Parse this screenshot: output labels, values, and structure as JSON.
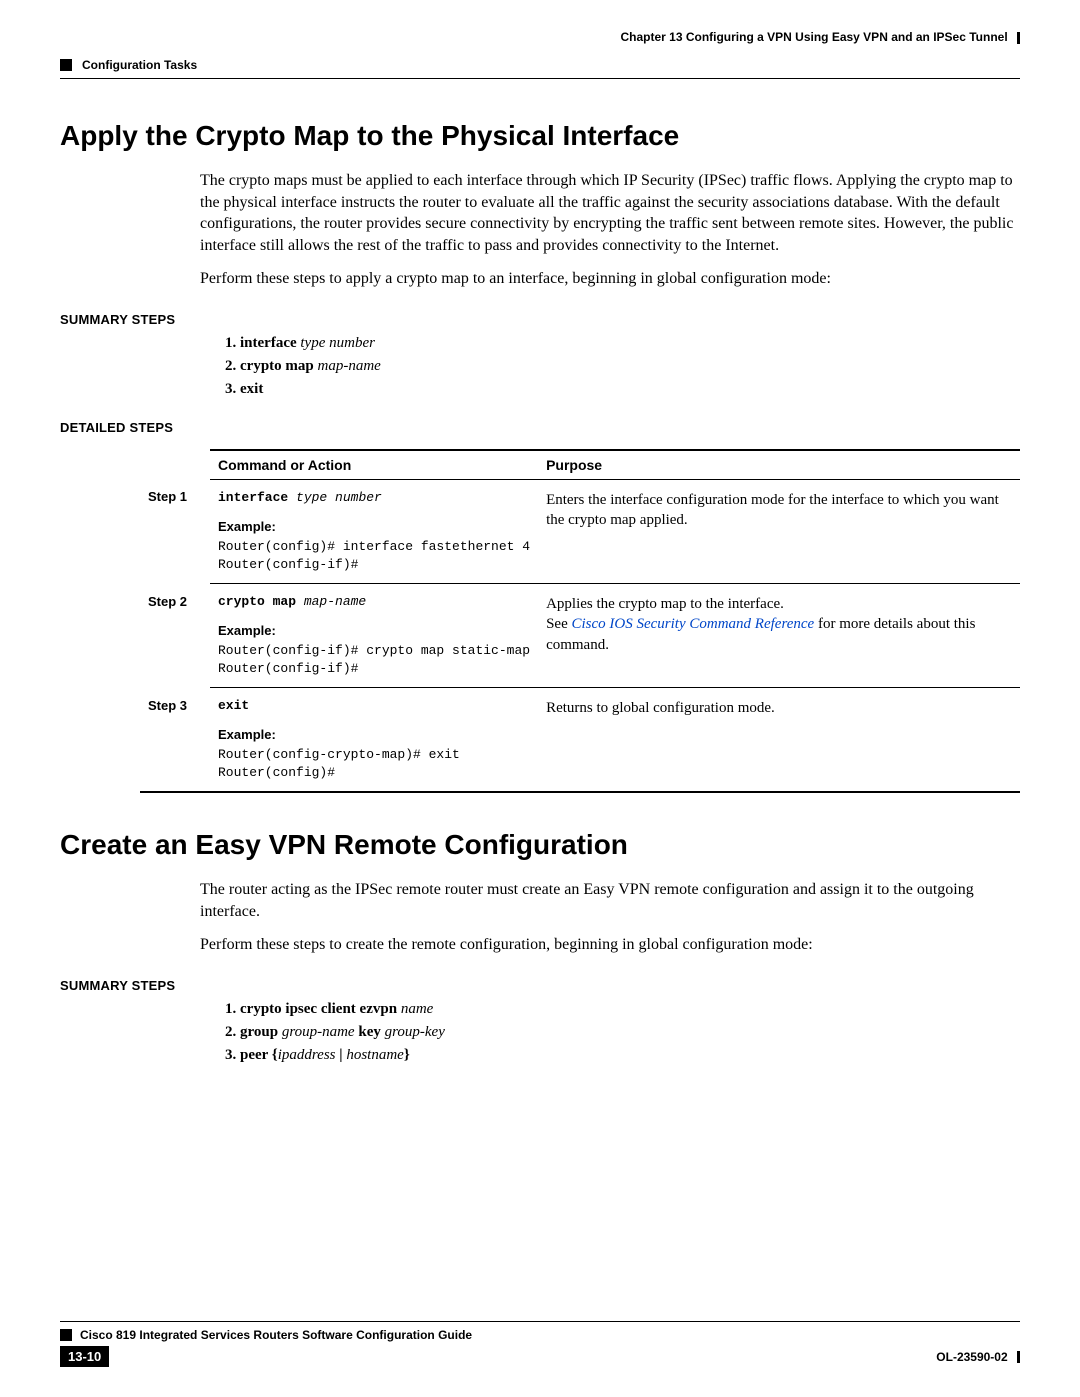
{
  "header": {
    "chapter": "Chapter 13    Configuring a VPN Using Easy VPN and an IPSec Tunnel",
    "subtitle": "Configuration Tasks"
  },
  "section1": {
    "title": "Apply the Crypto Map to the Physical Interface",
    "para1": "The crypto maps must be applied to each interface through which IP Security (IPSec) traffic flows. Applying the crypto map to the physical interface instructs the router to evaluate all the traffic against the security associations database. With the default configurations, the router provides secure connectivity by encrypting the traffic sent between remote sites. However, the public interface still allows the rest of the traffic to pass and provides connectivity to the Internet.",
    "para2": "Perform these steps to apply a crypto map to an interface, beginning in global configuration mode:",
    "summary_label": "SUMMARY STEPS",
    "summary": [
      {
        "kw": "interface",
        "arg": "type number"
      },
      {
        "kw": "crypto map",
        "arg": "map-name"
      },
      {
        "kw": "exit",
        "arg": ""
      }
    ],
    "detailed_label": "DETAILED STEPS",
    "table": {
      "head_cmd": "Command or Action",
      "head_purpose": "Purpose",
      "rows": [
        {
          "step": "Step 1",
          "cmd_kw": "interface",
          "cmd_arg": "type number",
          "ex_label": "Example:",
          "ex": "Router(config)# interface fastethernet 4\nRouter(config-if)#",
          "purpose": "Enters the interface configuration mode for the interface to which you want the crypto map applied."
        },
        {
          "step": "Step 2",
          "cmd_kw": "crypto map",
          "cmd_arg": "map-name",
          "ex_label": "Example:",
          "ex": "Router(config-if)# crypto map static-map\nRouter(config-if)#",
          "purpose_pre": "Applies the crypto map to the interface.",
          "purpose_see_pre": "See ",
          "purpose_link": "Cisco IOS Security Command Reference",
          "purpose_see_post": " for more details about this command."
        },
        {
          "step": "Step 3",
          "cmd_kw": "exit",
          "cmd_arg": "",
          "ex_label": "Example:",
          "ex": "Router(config-crypto-map)# exit\nRouter(config)#",
          "purpose": "Returns to global configuration mode."
        }
      ]
    }
  },
  "section2": {
    "title": "Create an Easy VPN Remote Configuration",
    "para1": "The router acting as the IPSec remote router must create an Easy VPN remote configuration and assign it to the outgoing interface.",
    "para2": "Perform these steps to create the remote configuration, beginning in global configuration mode:",
    "summary_label": "SUMMARY STEPS",
    "summary": [
      {
        "kw": "crypto ipsec client ezvpn",
        "arg": "name"
      },
      {
        "kw_a": "group",
        "arg_a": "group-name",
        "kw_b": "key",
        "arg_b": "group-key"
      },
      {
        "kw": "peer",
        "arg_brace": "{ipaddress | hostname}"
      }
    ]
  },
  "footer": {
    "guide": "Cisco 819 Integrated Services Routers Software Configuration Guide",
    "page": "13-10",
    "doc": "OL-23590-02"
  }
}
